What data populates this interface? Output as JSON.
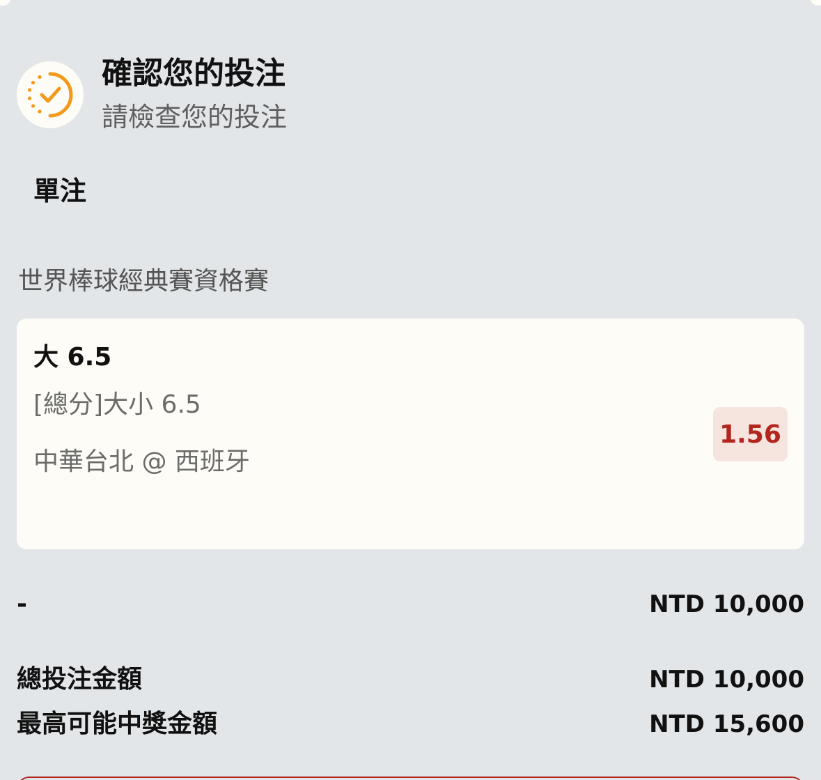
{
  "header": {
    "icon": "check-circle-icon",
    "title": "確認您的投注",
    "subtitle": "請檢查您的投注"
  },
  "section": {
    "label": "單注"
  },
  "league": "世界棒球經典賽資格賽",
  "bet": {
    "selection": "大 6.5",
    "market": "[總分]大小 6.5",
    "match": "中華台北 @ 西班牙",
    "odds": "1.56"
  },
  "summary": {
    "stake_label": "-",
    "stake_amount": "NTD 10,000",
    "total_label": "總投注金額",
    "total_amount": "NTD 10,000",
    "max_win_label": "最高可能中獎金額",
    "max_win_amount": "NTD 15,600"
  },
  "colors": {
    "background": "#e3e6e8",
    "card": "#fdfcf6",
    "accent_orange": "#f39a1c",
    "odds_text": "#b3261e",
    "odds_bg": "#f6e4df"
  }
}
